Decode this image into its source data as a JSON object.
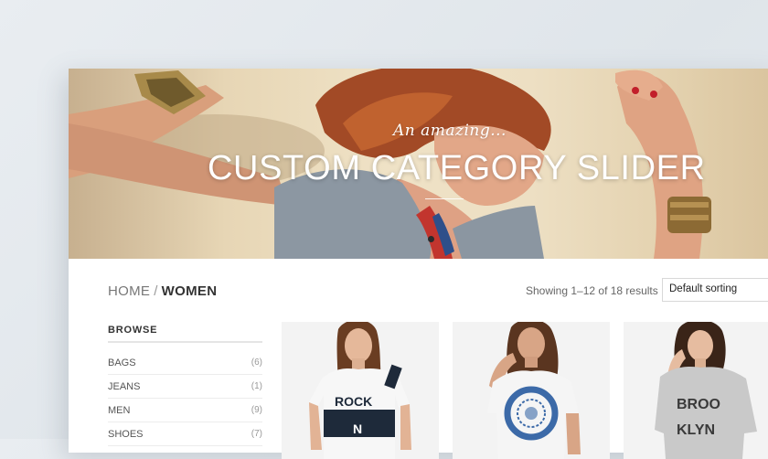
{
  "hero": {
    "kicker": "An amazing...",
    "title": "CUSTOM CATEGORY SLIDER",
    "dots": 2,
    "active_dot": 0
  },
  "breadcrumb": {
    "home": "HOME",
    "separator": "/",
    "current": "WOMEN"
  },
  "results_text": "Showing 1–12 of 18 results",
  "sorting": {
    "selected": "Default sorting"
  },
  "sidebar": {
    "title": "BROWSE",
    "categories": [
      {
        "label": "BAGS",
        "count": "(6)"
      },
      {
        "label": "JEANS",
        "count": "(1)"
      },
      {
        "label": "MEN",
        "count": "(9)"
      },
      {
        "label": "SHOES",
        "count": "(7)"
      }
    ]
  },
  "products": [
    {
      "print": [
        "ROCK",
        "N"
      ]
    },
    {
      "print": []
    },
    {
      "print": [
        "BROO",
        "KLYN"
      ]
    }
  ],
  "colors": {
    "background": "#e5eaee",
    "accent_text": "#333333",
    "muted_text": "#777777"
  }
}
